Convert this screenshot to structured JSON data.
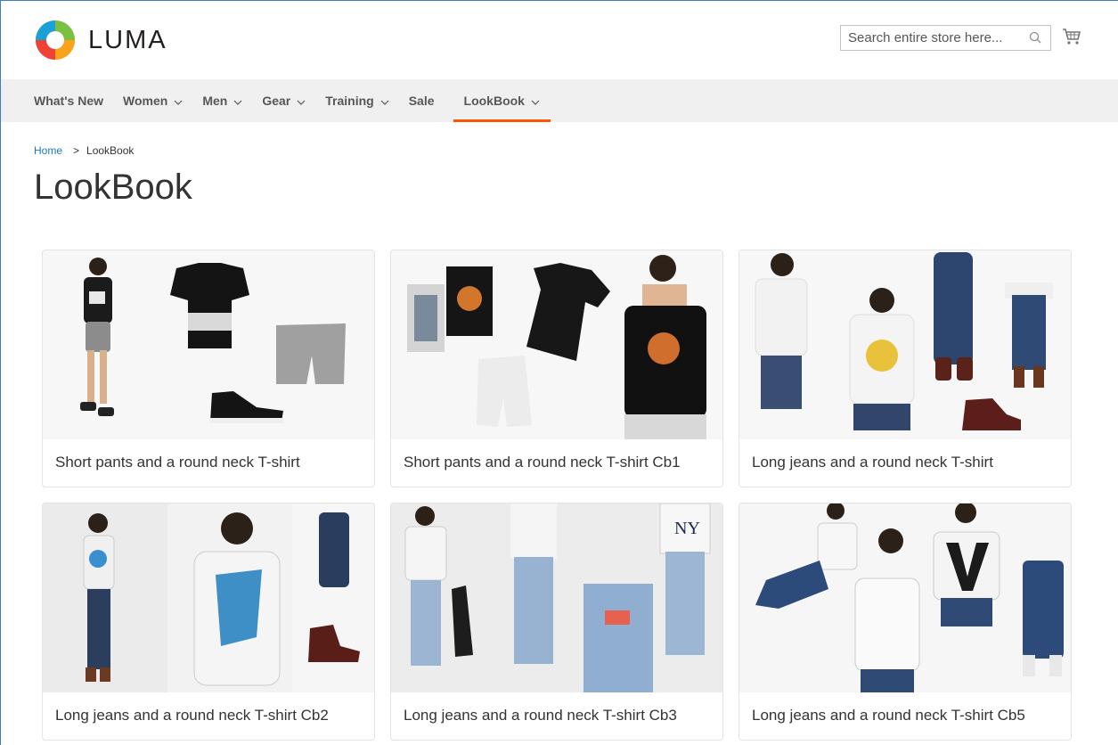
{
  "header": {
    "logo_text": "LUMA",
    "search_placeholder": "Search entire store here...",
    "icons": [
      "luma-logo",
      "search-icon",
      "cart-icon"
    ]
  },
  "nav": {
    "items": [
      {
        "label": "What's New",
        "has_dropdown": false
      },
      {
        "label": "Women",
        "has_dropdown": true
      },
      {
        "label": "Men",
        "has_dropdown": true
      },
      {
        "label": "Gear",
        "has_dropdown": true
      },
      {
        "label": "Training",
        "has_dropdown": true
      },
      {
        "label": "Sale",
        "has_dropdown": false
      },
      {
        "label": "LookBook",
        "has_dropdown": true,
        "active": true
      }
    ]
  },
  "breadcrumbs": {
    "home": "Home",
    "current": "LookBook"
  },
  "page_title": "LookBook",
  "lookbooks": [
    {
      "caption": "Short pants and a round neck T-shirt"
    },
    {
      "caption": "Short pants and a round neck T-shirt Cb1"
    },
    {
      "caption": "Long jeans and a round neck T-shirt"
    },
    {
      "caption": "Long jeans and a round neck T-shirt Cb2"
    },
    {
      "caption": "Long jeans and a round neck T-shirt Cb3"
    },
    {
      "caption": "Long jeans and a round neck T-shirt Cb5"
    }
  ],
  "colors": {
    "accent": "#ff5501",
    "link": "#1979c3",
    "nav_bg": "#f0f0f0"
  }
}
